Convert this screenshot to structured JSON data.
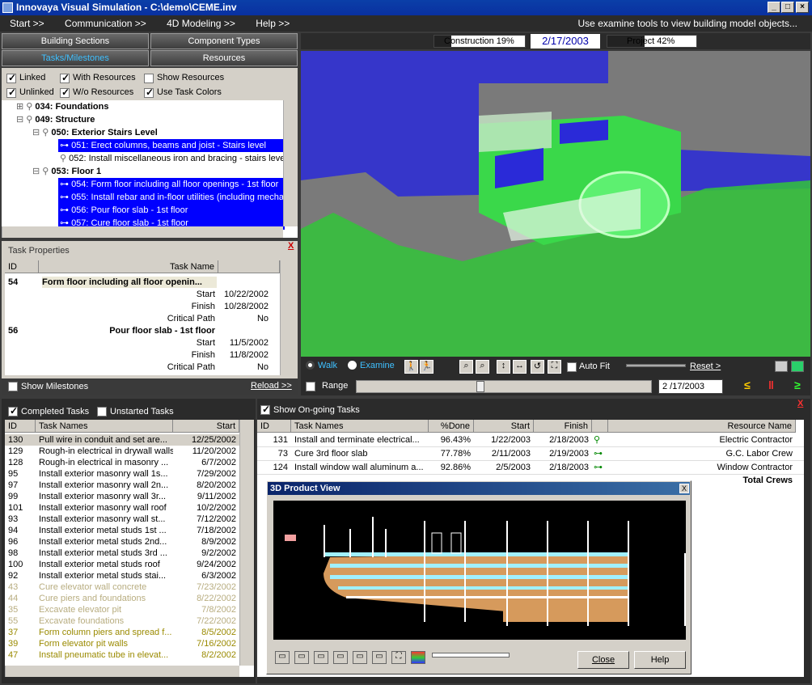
{
  "window": {
    "title": "Innovaya Visual Simulation - C:\\demo\\CEME.inv"
  },
  "menu": {
    "items": [
      "Start >>",
      "Communication >>",
      "4D Modeling >>",
      "Help >>"
    ],
    "hint": "Use examine tools to view building model objects..."
  },
  "tabs": {
    "building_sections": "Building Sections",
    "component_types": "Component Types",
    "tasks_milestones": "Tasks/Milestones",
    "resources": "Resources"
  },
  "filters": {
    "linked": "Linked",
    "with_resources": "With Resources",
    "show_resources": "Show Resources",
    "unlinked": "Unlinked",
    "wo_resources": "W/o Resources",
    "use_task_colors": "Use Task Colors"
  },
  "tree": [
    {
      "text": "034: Foundations",
      "bold": true
    },
    {
      "text": "049: Structure",
      "bold": true
    },
    {
      "text": "050: Exterior Stairs Level",
      "bold": true
    },
    {
      "text": "051: Erect  columns, beams and joist - Stairs level",
      "bold": false
    },
    {
      "text": "052: Install miscellaneous iron and bracing - stairs leve",
      "bold": false
    },
    {
      "text": "053: Floor 1",
      "bold": true
    },
    {
      "text": "054: Form floor including all floor openings - 1st floor",
      "bold": false
    },
    {
      "text": "055: Install rebar and in-floor utilities (including mecha",
      "bold": false
    },
    {
      "text": "056: Pour floor slab - 1st floor",
      "bold": false
    },
    {
      "text": "057: Cure floor slab - 1st floor",
      "bold": false
    }
  ],
  "task_props": {
    "title": "Task Properties",
    "close": "X",
    "col_id": "ID",
    "col_name": "Task Name",
    "t1": {
      "id": "54",
      "name": "Form floor including all floor openin...",
      "start_label": "Start",
      "start": "10/22/2002",
      "finish_label": "Finish",
      "finish": "10/28/2002",
      "cp_label": "Critical Path",
      "cp": "No"
    },
    "t2": {
      "id": "56",
      "name": "Pour floor slab - 1st floor",
      "start_label": "Start",
      "start": "11/5/2002",
      "finish_label": "Finish",
      "finish": "11/8/2002",
      "cp_label": "Critical Path",
      "cp": "No"
    },
    "show_milestones": "Show Milestones",
    "reload": "Reload >>"
  },
  "status": {
    "construction": "Construction 19%",
    "date": "2/17/2003",
    "project": "Project 42%",
    "construction_pct": 19,
    "project_pct": 42
  },
  "nav": {
    "walk": "Walk",
    "examine": "Examine",
    "auto_fit": "Auto Fit",
    "reset": "Reset >",
    "range": "Range",
    "date": "2 /17/2003"
  },
  "completed": {
    "completed_label": "Completed Tasks",
    "unstarted_label": "Unstarted Tasks",
    "col_id": "ID",
    "col_name": "Task Names",
    "col_start": "Start",
    "rows": [
      {
        "id": "130",
        "name": "Pull wire in conduit and set are...",
        "start": "12/25/2002",
        "c": "n"
      },
      {
        "id": "129",
        "name": "Rough-in electrical in drywall walls",
        "start": "11/20/2002",
        "c": "n"
      },
      {
        "id": "128",
        "name": "Rough-in electrical in masonry ...",
        "start": "6/7/2002",
        "c": "n"
      },
      {
        "id": "95",
        "name": "Install exterior masonry wall 1s...",
        "start": "7/29/2002",
        "c": "n"
      },
      {
        "id": "97",
        "name": "Install exterior masonry wall 2n...",
        "start": "8/20/2002",
        "c": "n"
      },
      {
        "id": "99",
        "name": "Install exterior masonry wall 3r...",
        "start": "9/11/2002",
        "c": "n"
      },
      {
        "id": "101",
        "name": "Install exterior masonry wall roof",
        "start": "10/2/2002",
        "c": "n"
      },
      {
        "id": "93",
        "name": "Install exterior masonry wall st...",
        "start": "7/12/2002",
        "c": "n"
      },
      {
        "id": "94",
        "name": "Install exterior metal studs 1st ...",
        "start": "7/18/2002",
        "c": "n"
      },
      {
        "id": "96",
        "name": "Install exterior metal studs 2nd...",
        "start": "8/9/2002",
        "c": "n"
      },
      {
        "id": "98",
        "name": "Install exterior metal studs 3rd ...",
        "start": "9/2/2002",
        "c": "n"
      },
      {
        "id": "100",
        "name": "Install exterior metal studs roof",
        "start": "9/24/2002",
        "c": "n"
      },
      {
        "id": "92",
        "name": "Install exterior metal studs stai...",
        "start": "6/3/2002",
        "c": "n"
      },
      {
        "id": "43",
        "name": "Cure elevator wall concrete",
        "start": "7/23/2002",
        "c": "g"
      },
      {
        "id": "44",
        "name": "Cure piers and foundations",
        "start": "8/22/2002",
        "c": "g"
      },
      {
        "id": "35",
        "name": "Excavate elevator pit",
        "start": "7/8/2002",
        "c": "g"
      },
      {
        "id": "55",
        "name": "Excavate foundations",
        "start": "7/22/2002",
        "c": "g"
      },
      {
        "id": "37",
        "name": "Form column piers and spread f...",
        "start": "8/5/2002",
        "c": "y"
      },
      {
        "id": "39",
        "name": "Form elevator pit walls",
        "start": "7/16/2002",
        "c": "y"
      },
      {
        "id": "47",
        "name": "Install pneumatic tube in elevat...",
        "start": "8/2/2002",
        "c": "y"
      }
    ]
  },
  "ongoing": {
    "show_label": "Show On-going Tasks",
    "close": "X",
    "col_id": "ID",
    "col_name": "Task Names",
    "col_done": "%Done",
    "col_start": "Start",
    "col_finish": "Finish",
    "col_resource": "Resource Name",
    "rows": [
      {
        "id": "131",
        "name": "Install and terminate electrical...",
        "done": "96.43%",
        "start": "1/22/2003",
        "finish": "2/18/2003",
        "resource": "Electric Contractor"
      },
      {
        "id": "73",
        "name": "Cure 3rd floor slab",
        "done": "77.78%",
        "start": "2/11/2003",
        "finish": "2/19/2003",
        "resource": "G.C. Labor Crew"
      },
      {
        "id": "124",
        "name": "Install window wall aluminum a...",
        "done": "92.86%",
        "start": "2/5/2003",
        "finish": "2/18/2003",
        "resource": "Window Contractor"
      }
    ],
    "total_crews": "Total Crews"
  },
  "product_view": {
    "title": "3D Product View",
    "close_x": "X",
    "close_btn": "Close",
    "help_btn": "Help"
  },
  "colors": {
    "selection": "#0000ff",
    "model_blue": "#2222e0",
    "model_green": "#33cc33",
    "slab": "#d69a5c",
    "cyan": "#a0f0ff"
  }
}
